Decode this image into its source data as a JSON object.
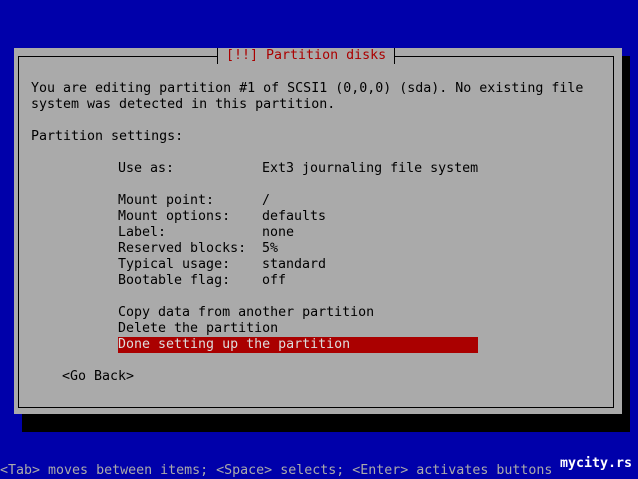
{
  "dialog": {
    "title": "[!!] Partition disks",
    "intro_line1": "You are editing partition #1 of SCSI1 (0,0,0) (sda). No existing file",
    "intro_line2": "system was detected in this partition.",
    "settings_heading": "Partition settings:",
    "settings": [
      {
        "label": "Use as:",
        "value": "Ext3 journaling file system"
      },
      {
        "label": "Mount point:",
        "value": "/"
      },
      {
        "label": "Mount options:",
        "value": "defaults"
      },
      {
        "label": "Label:",
        "value": "none"
      },
      {
        "label": "Reserved blocks:",
        "value": "5%"
      },
      {
        "label": "Typical usage:",
        "value": "standard"
      },
      {
        "label": "Bootable flag:",
        "value": "off"
      }
    ],
    "actions": [
      "Copy data from another partition",
      "Delete the partition",
      "Done setting up the partition"
    ],
    "go_back": "<Go Back>"
  },
  "footer": {
    "help": "<Tab> moves between items; <Space> selects; <Enter> activates buttons",
    "brand": "mycity.rs"
  },
  "colors": {
    "background": "#0000aa",
    "dialog": "#aaaaaa",
    "accent": "#aa0000"
  }
}
